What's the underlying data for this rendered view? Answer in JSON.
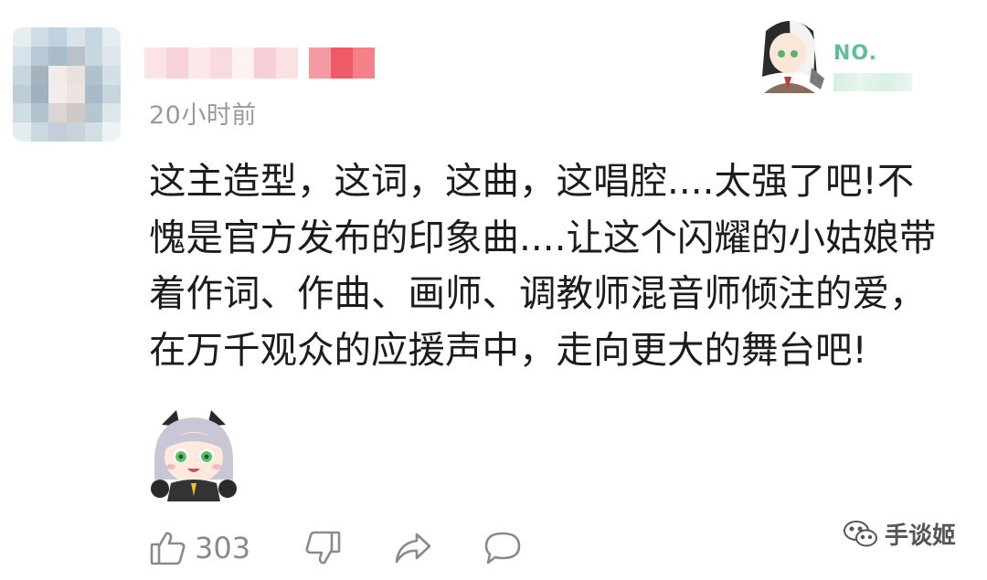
{
  "comment": {
    "timestamp": "20小时前",
    "lines": [
      "这主造型，这词，这曲，这唱腔....太强了吧!不",
      "愧是官方发布的印象曲....让这个闪耀的小姑娘带",
      "着作词、作曲、画师、调教师混音师倾注的爱，",
      "在万千观众的应援声中，走向更大的舞台吧!"
    ]
  },
  "badge": {
    "label": "NO."
  },
  "actions": {
    "like_count": "303"
  },
  "watermark": {
    "text": "手谈姬"
  },
  "colors": {
    "text": "#1c1c1c",
    "muted": "#9a9a9a",
    "icon": "#8a8a8a",
    "badge_green": "#5fbf9a"
  },
  "icons": {
    "like": "thumbs-up-icon",
    "dislike": "thumbs-down-icon",
    "share": "share-arrow-icon",
    "reply": "speech-bubble-icon"
  }
}
